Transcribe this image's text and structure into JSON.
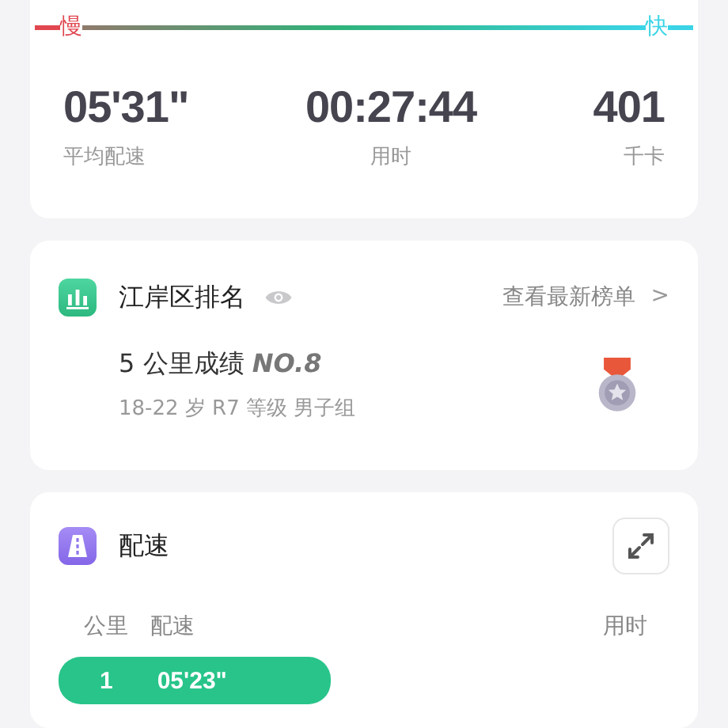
{
  "speed_scale": {
    "slow_label": "慢",
    "fast_label": "快"
  },
  "stats": [
    {
      "value": "05'31\"",
      "label": "平均配速"
    },
    {
      "value": "00:27:44",
      "label": "用时"
    },
    {
      "value": "401",
      "label": "千卡"
    }
  ],
  "ranking": {
    "title": "江岸区排名",
    "link": "查看最新榜单",
    "chevron": ">",
    "result": "5 公里成绩 *NO.8*",
    "details": "18-22 岁 R7 等级 男子组"
  },
  "pace": {
    "title": "配速",
    "columns": [
      "公里",
      "配速",
      "用时"
    ],
    "rows": [
      {
        "km": "1",
        "pace": "05'23\""
      }
    ]
  }
}
